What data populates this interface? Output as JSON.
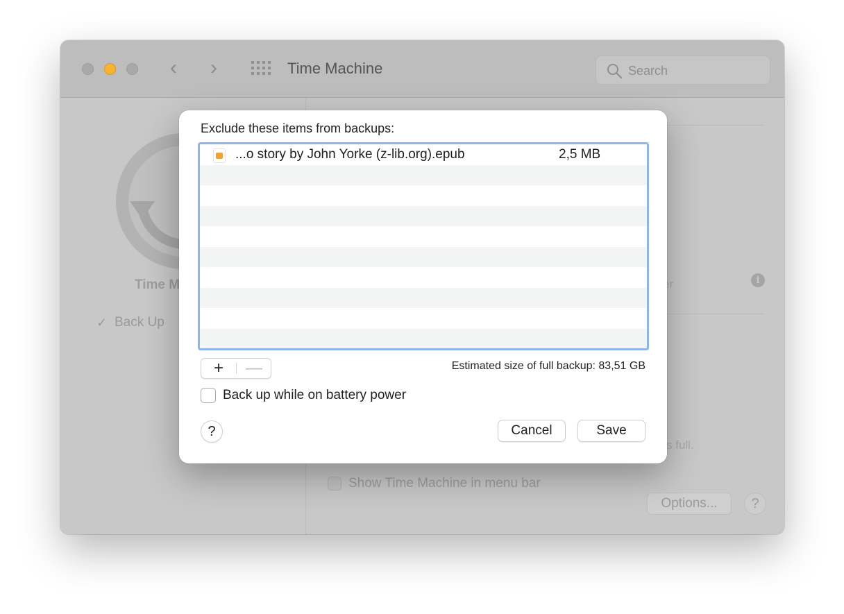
{
  "window": {
    "title": "Time Machine",
    "search_placeholder": "Search"
  },
  "background": {
    "app_label": "Time M",
    "back_up_label": "Back Up",
    "right_text_1": "er",
    "right_text_2": "s full.",
    "show_in_menu_bar_label": "Show Time Machine in menu bar",
    "options_label": "Options...",
    "help_label": "?"
  },
  "sheet": {
    "heading": "Exclude these items from backups:",
    "items": [
      {
        "name": "...o story by John Yorke (z-lib.org).epub",
        "size": "2,5 MB",
        "icon": "epub-file-icon"
      }
    ],
    "add_label": "+",
    "remove_label": "—",
    "estimated_size": "Estimated size of full backup: 83,51 GB",
    "battery_label": "Back up while on battery power",
    "battery_checked": false,
    "help_label": "?",
    "cancel_label": "Cancel",
    "save_label": "Save"
  },
  "colors": {
    "accent_focus_ring": "#8fb4ec",
    "traffic_yellow": "#f5b431"
  }
}
